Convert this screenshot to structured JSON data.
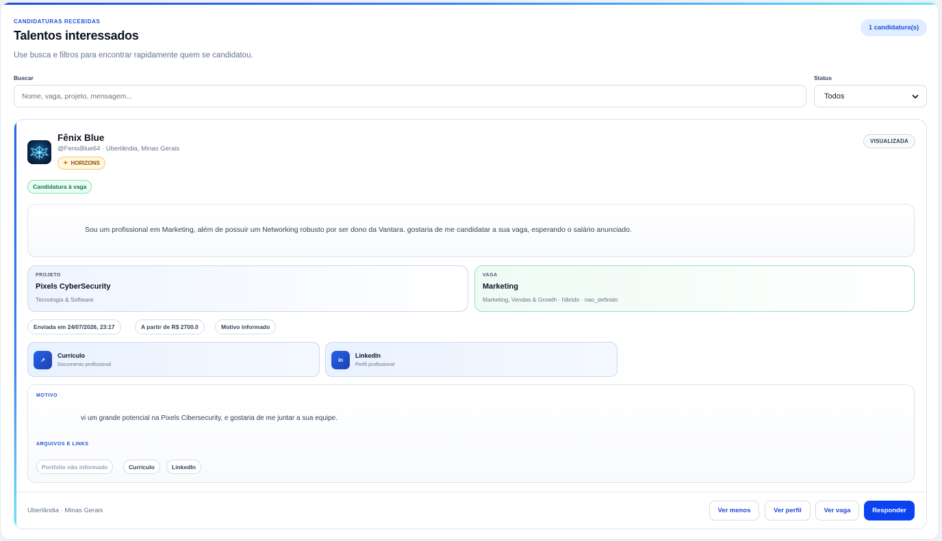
{
  "header": {
    "eyebrow": "CANDIDATURAS RECEBIDAS",
    "title": "Talentos interessados",
    "subtitle": "Use busca e filtros para encontrar rapidamente quem se candidatou.",
    "count_badge": "1 candidatura(s)"
  },
  "filters": {
    "search_label": "Buscar",
    "search_placeholder": "Nome, vaga, projeto, mensagem...",
    "search_value": "",
    "status_label": "Status",
    "status_value": "Todos"
  },
  "candidate": {
    "name": "Fênix Blue",
    "handle_location": "@FenixBlue64 · Uberlândia, Minas Gerais",
    "plan_icon": "sparkle-icon",
    "plan": "HORIZONS",
    "view_status": "VISUALIZADA",
    "application_type": "Candidatura à vaga",
    "message": "Sou um profissional em Marketing, além de possuir um Networking robusto por ser dono da Vantara. gostaria de me candidatar a sua vaga, esperando o salário anunciado.",
    "project": {
      "eyebrow": "PROJETO",
      "title": "Pixels CyberSecurity",
      "subtitle": "Tecnologia & Software"
    },
    "job": {
      "eyebrow": "VAGA",
      "title": "Marketing",
      "subtitle": "Marketing, Vendas & Growth · hibrido · nao_definido"
    },
    "chips": [
      "Enviada em 24/07/2026, 23:17",
      "A partir de R$ 2700.0",
      "Motivo informado"
    ],
    "links": [
      {
        "icon": "external-link-icon",
        "icon_glyph": "↗",
        "title": "Currículo",
        "subtitle": "Documento profissional"
      },
      {
        "icon": "linkedin-icon",
        "icon_glyph": "in",
        "title": "LinkedIn",
        "subtitle": "Perfil profissional"
      }
    ],
    "reason": {
      "eyebrow": "MOTIVO",
      "text": "vi um grande potencial na Pixels Cibersecurity, e gostaria de me juntar a sua equipe.",
      "files_eyebrow": "ARQUIVOS E LINKS",
      "files": [
        "Portfolio não informado",
        "Currículo",
        "LinkedIn"
      ]
    },
    "footer_location": "Uberlândia · Minas Gerais"
  },
  "actions": {
    "see_less": "Ver menos",
    "see_profile": "Ver perfil",
    "see_job": "Ver vaga",
    "reply": "Responder"
  },
  "colors": {
    "accent": "#1d4ed8",
    "primary_button": "#0b43f0",
    "success": "#047857",
    "warning": "#9a4a07"
  }
}
